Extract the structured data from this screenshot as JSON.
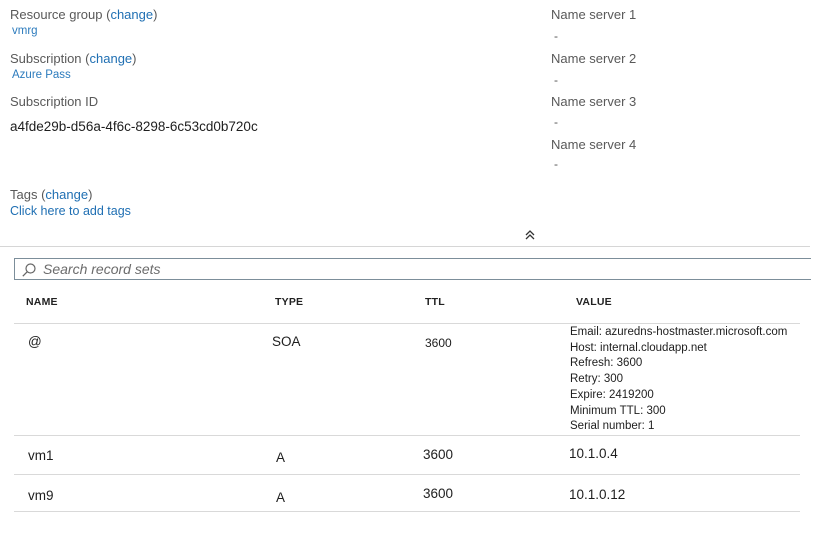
{
  "essentials": {
    "resource_group": {
      "label": "Resource group",
      "change": "change",
      "value": "vmrg"
    },
    "subscription": {
      "label": "Subscription",
      "change": "change",
      "value": "Azure Pass"
    },
    "subscription_id": {
      "label": "Subscription ID",
      "value": "a4fde29b-d56a-4f6c-8298-6c53cd0b720c"
    },
    "tags": {
      "label": "Tags",
      "change": "change",
      "value": "Click here to add tags"
    },
    "name_servers": [
      {
        "label": "Name server 1",
        "value": "-"
      },
      {
        "label": "Name server 2",
        "value": "-"
      },
      {
        "label": "Name server 3",
        "value": "-"
      },
      {
        "label": "Name server 4",
        "value": "-"
      }
    ],
    "collapse_icon": "double-chevron-up-icon"
  },
  "search": {
    "placeholder": "Search record sets",
    "value": "",
    "icon": "search-icon"
  },
  "table": {
    "columns": [
      "NAME",
      "TYPE",
      "TTL",
      "VALUE"
    ],
    "rows": [
      {
        "name": "@",
        "type": "SOA",
        "ttl": "3600",
        "value": [
          "Email: azuredns-hostmaster.microsoft.com",
          "Host: internal.cloudapp.net",
          "Refresh: 3600",
          "Retry: 300",
          "Expire: 2419200",
          "Minimum TTL: 300",
          "Serial number: 1"
        ]
      },
      {
        "name": "vm1",
        "type": "A",
        "ttl": "3600",
        "value": [
          "10.1.0.4"
        ]
      },
      {
        "name": "vm9",
        "type": "A",
        "ttl": "3600",
        "value": [
          "10.1.0.12"
        ]
      }
    ]
  },
  "colors": {
    "link": "#1f6fb3",
    "label": "#595959",
    "search_border": "#7c8e9a",
    "divider": "#d9d9d9"
  }
}
